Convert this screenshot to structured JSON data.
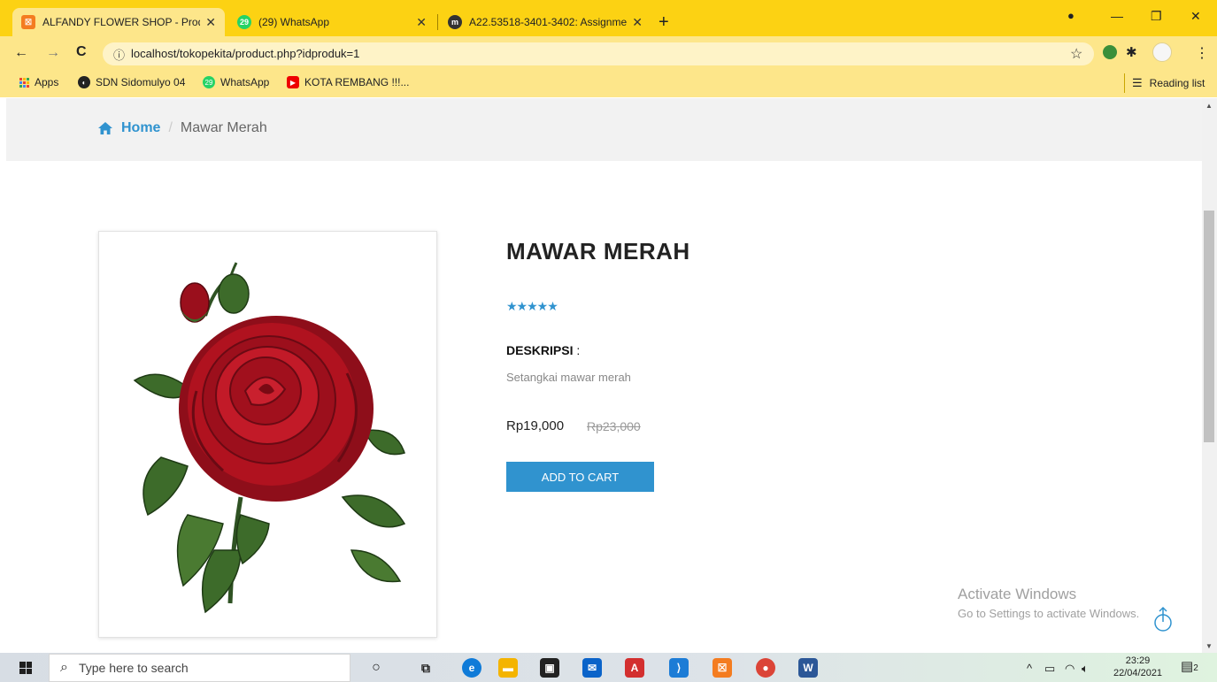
{
  "browser": {
    "tabs": [
      {
        "title": "ALFANDY FLOWER SHOP - Produ",
        "icon": "xampp-icon",
        "active": true
      },
      {
        "title": "(29) WhatsApp",
        "icon": "whatsapp-icon",
        "badge": "29"
      },
      {
        "title": "A22.53518-3401-3402: Assignme",
        "icon": "moodle-icon"
      }
    ],
    "url": "localhost/tokopekita/product.php?idproduk=1",
    "bookmarks": [
      {
        "label": "Apps"
      },
      {
        "label": "SDN Sidomulyo 04"
      },
      {
        "label": "WhatsApp",
        "badge": "29"
      },
      {
        "label": "KOTA REMBANG !!!..."
      }
    ],
    "reading_list": "Reading list"
  },
  "breadcrumb": {
    "home": "Home",
    "separator": "/",
    "current": "Mawar Merah"
  },
  "product": {
    "name": "MAWAR MERAH",
    "rating": 5,
    "stars": "★★★★★",
    "description_heading": "DESKRIPSI",
    "description_colon": " :",
    "description": "Setangkai mawar merah",
    "price": "Rp19,000",
    "old_price": "Rp23,000",
    "cart_button": "ADD TO CART"
  },
  "watermark": {
    "line1": "Activate Windows",
    "line2": "Go to Settings to activate Windows."
  },
  "taskbar": {
    "search_placeholder": "Type here to search",
    "time": "23:29",
    "date": "22/04/2021",
    "notification_count": "2"
  },
  "colors": {
    "chrome_yellow": "#fcd213",
    "accent_blue": "#3093cf",
    "rose_red": "#b0121f",
    "leaf_green": "#3d6b2a"
  }
}
